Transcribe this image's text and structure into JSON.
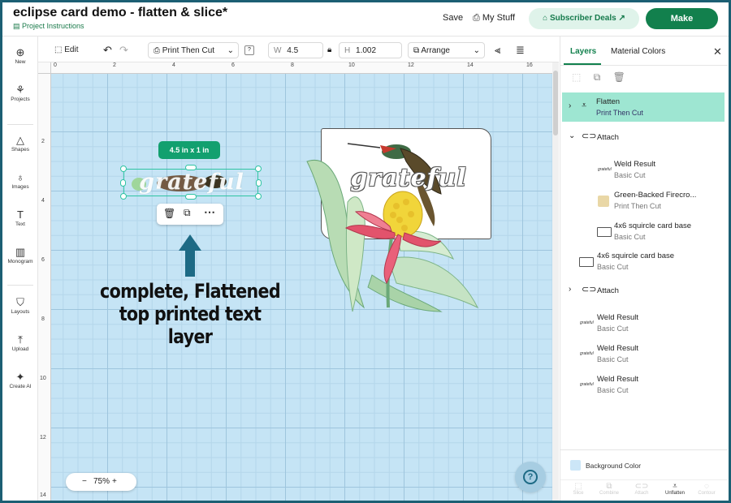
{
  "header": {
    "title": "eclipse card demo - flatten & slice*",
    "project_instructions": "Project Instructions",
    "save": "Save",
    "my_stuff": "My Stuff",
    "subscriber_deals": "Subscriber Deals ↗",
    "make": "Make"
  },
  "rail": {
    "items": [
      "New",
      "Projects",
      "Shapes",
      "Images",
      "Text",
      "Monogram",
      "Layouts",
      "Upload",
      "Create AI"
    ]
  },
  "toolbar": {
    "edit": "Edit",
    "operation": "Print Then Cut",
    "help": "?",
    "w_label": "W",
    "w_value": "4.5",
    "h_label": "H",
    "h_value": "1.002",
    "arrange": "Arrange"
  },
  "rulers": {
    "h": [
      "0",
      "2",
      "4",
      "6",
      "8",
      "10",
      "12",
      "14",
      "16"
    ],
    "v": [
      "2",
      "4",
      "6",
      "8",
      "10",
      "12",
      "14"
    ]
  },
  "canvas": {
    "size_tooltip": "4.5  in x 1  in",
    "selected_text": "grateful",
    "card_text": "grateful",
    "annotation_line1": "complete, Flattened",
    "annotation_line2": "top printed text layer",
    "zoom": "75%",
    "zoom_minus": "−",
    "zoom_plus": "+",
    "help": "?"
  },
  "layers_panel": {
    "tabs": [
      "Layers",
      "Material Colors"
    ],
    "close": "✕",
    "layers": [
      {
        "name": "Flatten",
        "sub": "Print Then Cut"
      },
      {
        "name": "Attach",
        "sub": ""
      },
      {
        "name": "Weld Result",
        "sub": "Basic Cut"
      },
      {
        "name": "Green-Backed Firecro...",
        "sub": "Print Then Cut"
      },
      {
        "name": "4x6 squircle card base",
        "sub": "Basic Cut"
      },
      {
        "name": "4x6 squircle card base",
        "sub": "Basic Cut"
      },
      {
        "name": "Attach",
        "sub": ""
      },
      {
        "name": "Weld Result",
        "sub": "Basic Cut"
      },
      {
        "name": "Weld Result",
        "sub": "Basic Cut"
      },
      {
        "name": "Weld Result",
        "sub": "Basic Cut"
      }
    ],
    "background_color": "Background Color",
    "bottom_actions": [
      "Slice",
      "Combine",
      "Attach",
      "Unflatten",
      "Contour"
    ]
  },
  "colors": {
    "brand_green": "#12804d",
    "selection_teal": "#2fc4a3",
    "annotation_blue": "#1d6a85",
    "canvas_blue": "#c5e4f5",
    "selected_row": "#9ee6d2"
  }
}
